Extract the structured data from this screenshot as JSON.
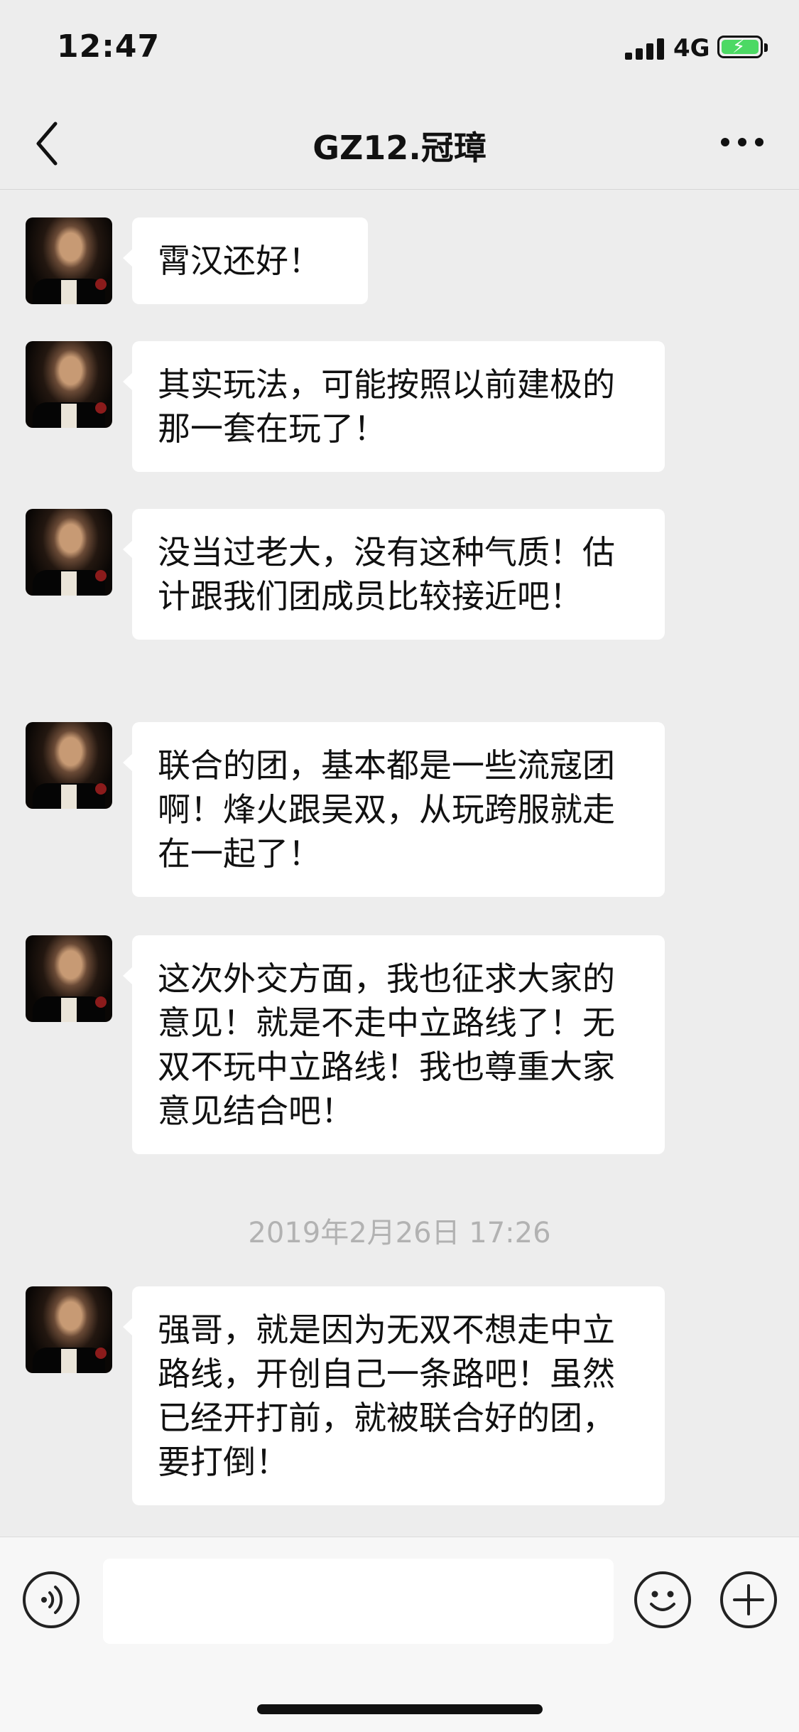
{
  "status_bar": {
    "time": "12:47",
    "network": "4G"
  },
  "nav": {
    "title": "GZ12.冠璋"
  },
  "messages": [
    {
      "text": "霄汉还好！"
    },
    {
      "text": "其实玩法，可能按照以前建极的那一套在玩了！"
    },
    {
      "text": "没当过老大，没有这种气质！估计跟我们团成员比较接近吧！"
    },
    {
      "text": "联合的团，基本都是一些流寇团啊！烽火跟吴双，从玩跨服就走在一起了！"
    },
    {
      "text": "这次外交方面，我也征求大家的意见！就是不走中立路线了！无双不玩中立路线！我也尊重大家意见结合吧！"
    },
    {
      "text": "强哥，就是因为无双不想走中立路线，开创自己一条路吧！虽然已经开打前，就被联合好的团，要打倒！"
    }
  ],
  "timestamp": "2019年2月26日 17:26",
  "input": {
    "value": ""
  },
  "colors": {
    "background": "#ededed",
    "bubble": "#ffffff",
    "battery": "#4cd964",
    "timestamp": "#b2b2b2"
  },
  "icons": {
    "back": "chevron-left-icon",
    "more": "more-dots-icon",
    "voice": "voice-icon",
    "emoji": "emoji-icon",
    "plus": "plus-icon"
  }
}
